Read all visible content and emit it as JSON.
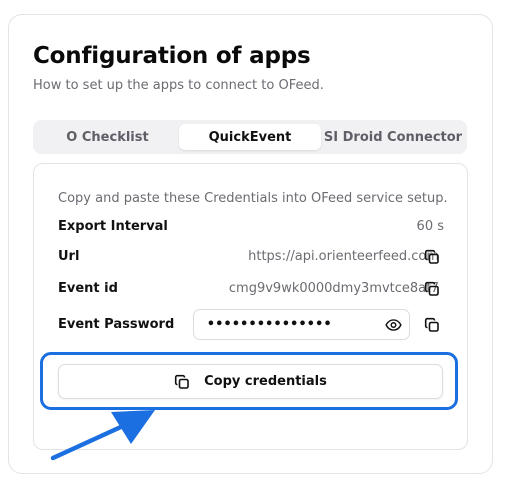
{
  "page": {
    "title": "Configuration of apps",
    "subtitle": "How to set up the apps to connect to OFeed."
  },
  "tabs": [
    {
      "label": "O Checklist",
      "selected": false
    },
    {
      "label": "QuickEvent",
      "selected": true
    },
    {
      "label": "SI Droid Connector",
      "selected": false
    }
  ],
  "panel": {
    "note": "Copy and paste these Credentials into OFeed service setup.",
    "fields": {
      "export_interval": {
        "label": "Export Interval",
        "value": "60 s"
      },
      "url": {
        "label": "Url",
        "value": "https://api.orienteerfeed.com"
      },
      "event_id": {
        "label": "Event id",
        "value": "cmg9v9wk0000dmy3mvtce8af7"
      },
      "event_password": {
        "label": "Event Password",
        "masked_value": "•••••••••••••••"
      }
    },
    "copy_button_label": "Copy credentials"
  },
  "icons": {
    "copy": "copy-icon",
    "visibility": "eye-icon",
    "annotation_arrow": "arrow-icon"
  },
  "colors": {
    "accent_highlight": "#1c6fe0",
    "text_primary": "#111111",
    "text_muted": "#6b6b72",
    "tab_bar_bg": "#f1f1f3"
  }
}
